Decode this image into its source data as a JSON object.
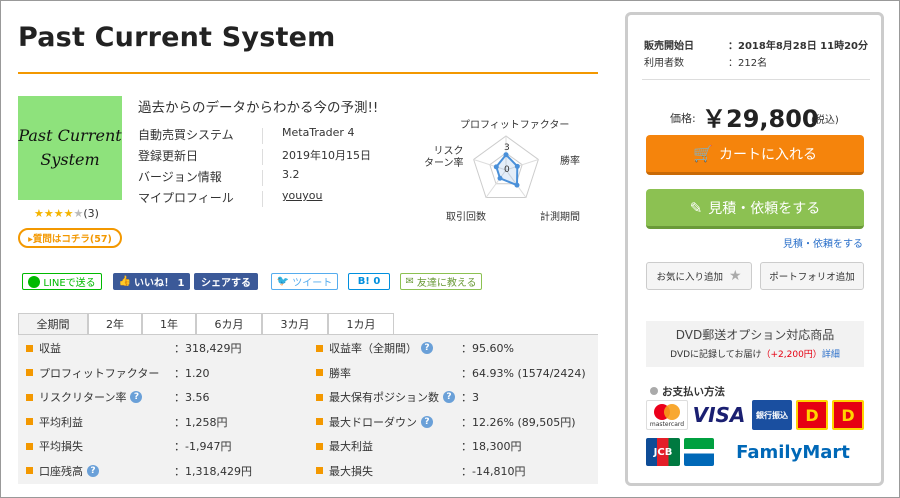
{
  "title": "Past Current System",
  "thumbnail": {
    "line1": "Past Current",
    "line2": "System"
  },
  "rating": {
    "stars_filled": 4,
    "stars_total": 5,
    "count_text": "(3)"
  },
  "review_button": "▸質問はコチラ(57)",
  "catch_copy": "過去からのデータからわかる今の予測!!",
  "info": [
    {
      "key": "自動売買システム",
      "value": "MetaTrader 4"
    },
    {
      "key": "登録更新日",
      "value": "2019年10月15日"
    },
    {
      "key": "バージョン情報",
      "value": "3.2"
    },
    {
      "key": "マイプロフィール",
      "value": "youyou"
    }
  ],
  "radar": {
    "labels": {
      "top": "プロフィットファクター",
      "right": "勝率",
      "bottom_right": "計測期間",
      "bottom_left": "取引回数",
      "left": "リスク\nターン率"
    },
    "scale_labels": [
      "3",
      "0"
    ],
    "values": [
      0.45,
      0.35,
      0.55,
      0.3,
      0.3
    ],
    "color": "#4a90d9"
  },
  "social": {
    "line": "LINEで送る",
    "like": "いいね！ 1",
    "share": "シェアする",
    "tweet": "ツイート",
    "hatena": "B! 0",
    "mail": "友達に教える"
  },
  "tabs": [
    "全期間",
    "2年",
    "1年",
    "6カ月",
    "3カ月",
    "1カ月"
  ],
  "stats_left": [
    {
      "label": "収益",
      "value": "：318,429円",
      "help": false
    },
    {
      "label": "プロフィットファクター",
      "value": "：1.20",
      "help": false
    },
    {
      "label": "リスクリターン率",
      "value": "：3.56",
      "help": true
    },
    {
      "label": "平均利益",
      "value": "：1,258円",
      "help": false
    },
    {
      "label": "平均損失",
      "value": "：-1,947円",
      "help": false
    },
    {
      "label": "口座残高",
      "value": "：1,318,429円",
      "help": true
    }
  ],
  "stats_right": [
    {
      "label": "収益率（全期間）",
      "value": "：95.60%",
      "help": true
    },
    {
      "label": "勝率",
      "value": "：64.93% (1574/2424)",
      "help": false
    },
    {
      "label": "最大保有ポジション数",
      "value": "：3",
      "help": true
    },
    {
      "label": "最大ドローダウン",
      "value": "：12.26% (89,505円)",
      "help": true
    },
    {
      "label": "最大利益",
      "value": "：18,300円",
      "help": false
    },
    {
      "label": "最大損失",
      "value": "：-14,810円",
      "help": false
    }
  ],
  "sidebar": {
    "sale_start_label": "販売開始日",
    "sale_start_value": "：2018年8月28日 11時20分",
    "users_label": "利用者数",
    "users_value": "：212名",
    "price_label": "価格:",
    "price": "￥29,800",
    "tax": "(税込)",
    "cart_button": "カートに入れる",
    "quote_button": "見積・依頼をする",
    "quote_link": "見積・依頼をする",
    "favorite_button": "お気に入り追加",
    "portfolio_button": "ポートフォリオ追加",
    "dvd_title": "DVD郵送オプション対応商品",
    "dvd_desc": "DVDに記録してお届け",
    "dvd_price": "（+2,200円）",
    "dvd_detail": "詳細",
    "payment_label": "お支払い方法",
    "cards": {
      "mastercard": "mastercard",
      "visa": "VISA",
      "bank": "銀行振込",
      "familymart": "FamilyMart",
      "jcb": "JCB"
    }
  },
  "colors": {
    "accent": "#f39800",
    "cart": "#f5840c",
    "quote": "#8cc152",
    "link": "#2a6fc9"
  }
}
